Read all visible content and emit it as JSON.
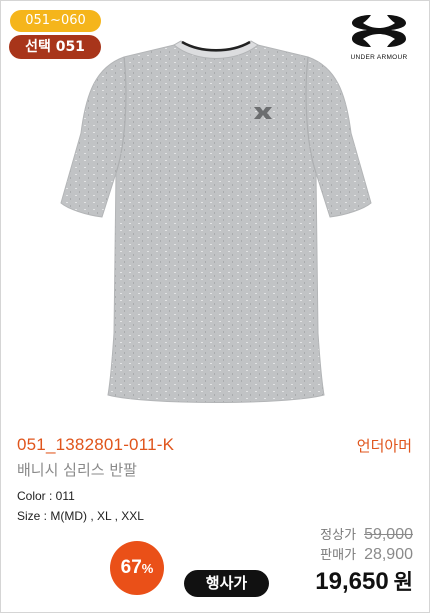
{
  "tags": {
    "range": "051~060",
    "selection": "선택 051"
  },
  "brand": {
    "logo_text": "UNDER ARMOUR",
    "icon": "under-armour-logo-icon"
  },
  "product": {
    "image": "gray-tshirt-image",
    "code": "051_1382801-011-K",
    "brand_kr": "언더아머",
    "name": "배니시 심리스 반팔",
    "color_line": "Color : 011",
    "size_line": "Size : M(MD) , XL , XXL"
  },
  "pricing": {
    "normal_label": "정상가",
    "normal_price": "59,000",
    "sale_label": "판매가",
    "sale_price": "28,900",
    "discount_num": "67",
    "discount_symbol": "%",
    "event_label": "행사가",
    "final_price": "19,650",
    "final_unit": "원"
  },
  "colors": {
    "accent": "#e0551c",
    "range_tag": "#f5b51b",
    "select_tag": "#a8351a",
    "discount": "#ea5018"
  }
}
